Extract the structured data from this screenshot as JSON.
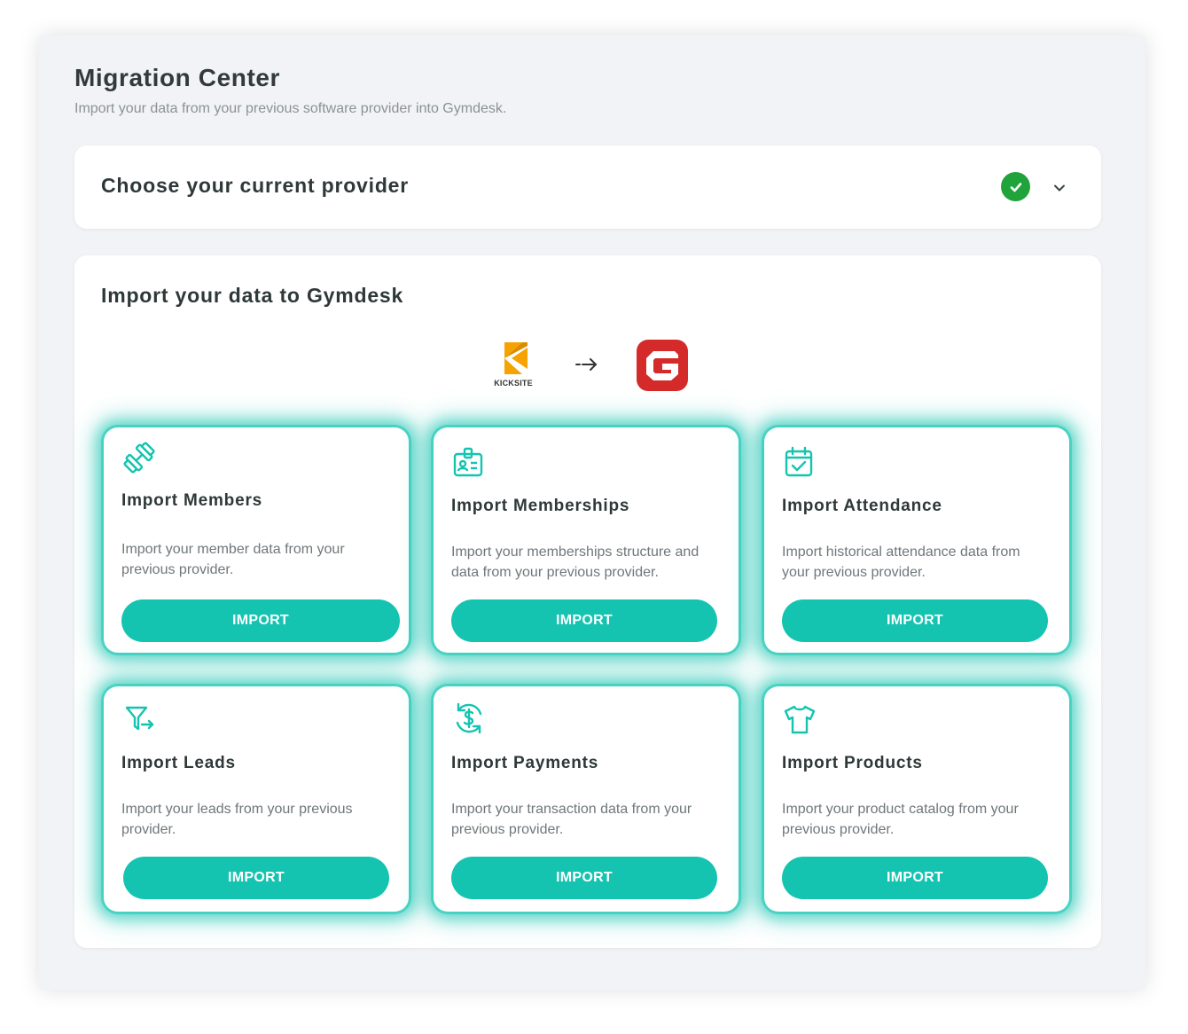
{
  "page": {
    "title": "Migration Center",
    "subtitle": "Import your data from your previous software provider into Gymdesk."
  },
  "provider_section": {
    "title": "Choose your current provider",
    "status": "complete",
    "status_icon": "check-circle-icon",
    "expand_icon": "chevron-down-icon"
  },
  "import_section": {
    "title": "Import your data to Gymdesk",
    "source_logo": {
      "name": "kicksite-logo",
      "text": "KICKSITE",
      "color": "#f5a300"
    },
    "arrow_icon": "dashed-arrow-right-icon",
    "target_logo": {
      "name": "gymdesk-logo",
      "color": "#d42a2a"
    }
  },
  "colors": {
    "accent": "#14c4b0",
    "success": "#1fa33a",
    "page_background": "#f2f3f6"
  },
  "cards": [
    {
      "icon": "dumbbell-icon",
      "title": "Import Members",
      "description": "Import your member data from your previous provider.",
      "button_label": "IMPORT"
    },
    {
      "icon": "id-badge-icon",
      "title": "Import Memberships",
      "description": "Import your memberships structure and data from your previous provider.",
      "button_label": "IMPORT"
    },
    {
      "icon": "calendar-check-icon",
      "title": "Import Attendance",
      "description": "Import historical attendance data from your previous provider.",
      "button_label": "IMPORT"
    },
    {
      "icon": "funnel-arrow-icon",
      "title": "Import Leads",
      "description": "Import your leads from your previous provider.",
      "button_label": "IMPORT"
    },
    {
      "icon": "dollar-sync-icon",
      "title": "Import Payments",
      "description": "Import your transaction data from your previous provider.",
      "button_label": "IMPORT"
    },
    {
      "icon": "tshirt-icon",
      "title": "Import Products",
      "description": "Import your product catalog from your previous provider.",
      "button_label": "IMPORT"
    }
  ]
}
